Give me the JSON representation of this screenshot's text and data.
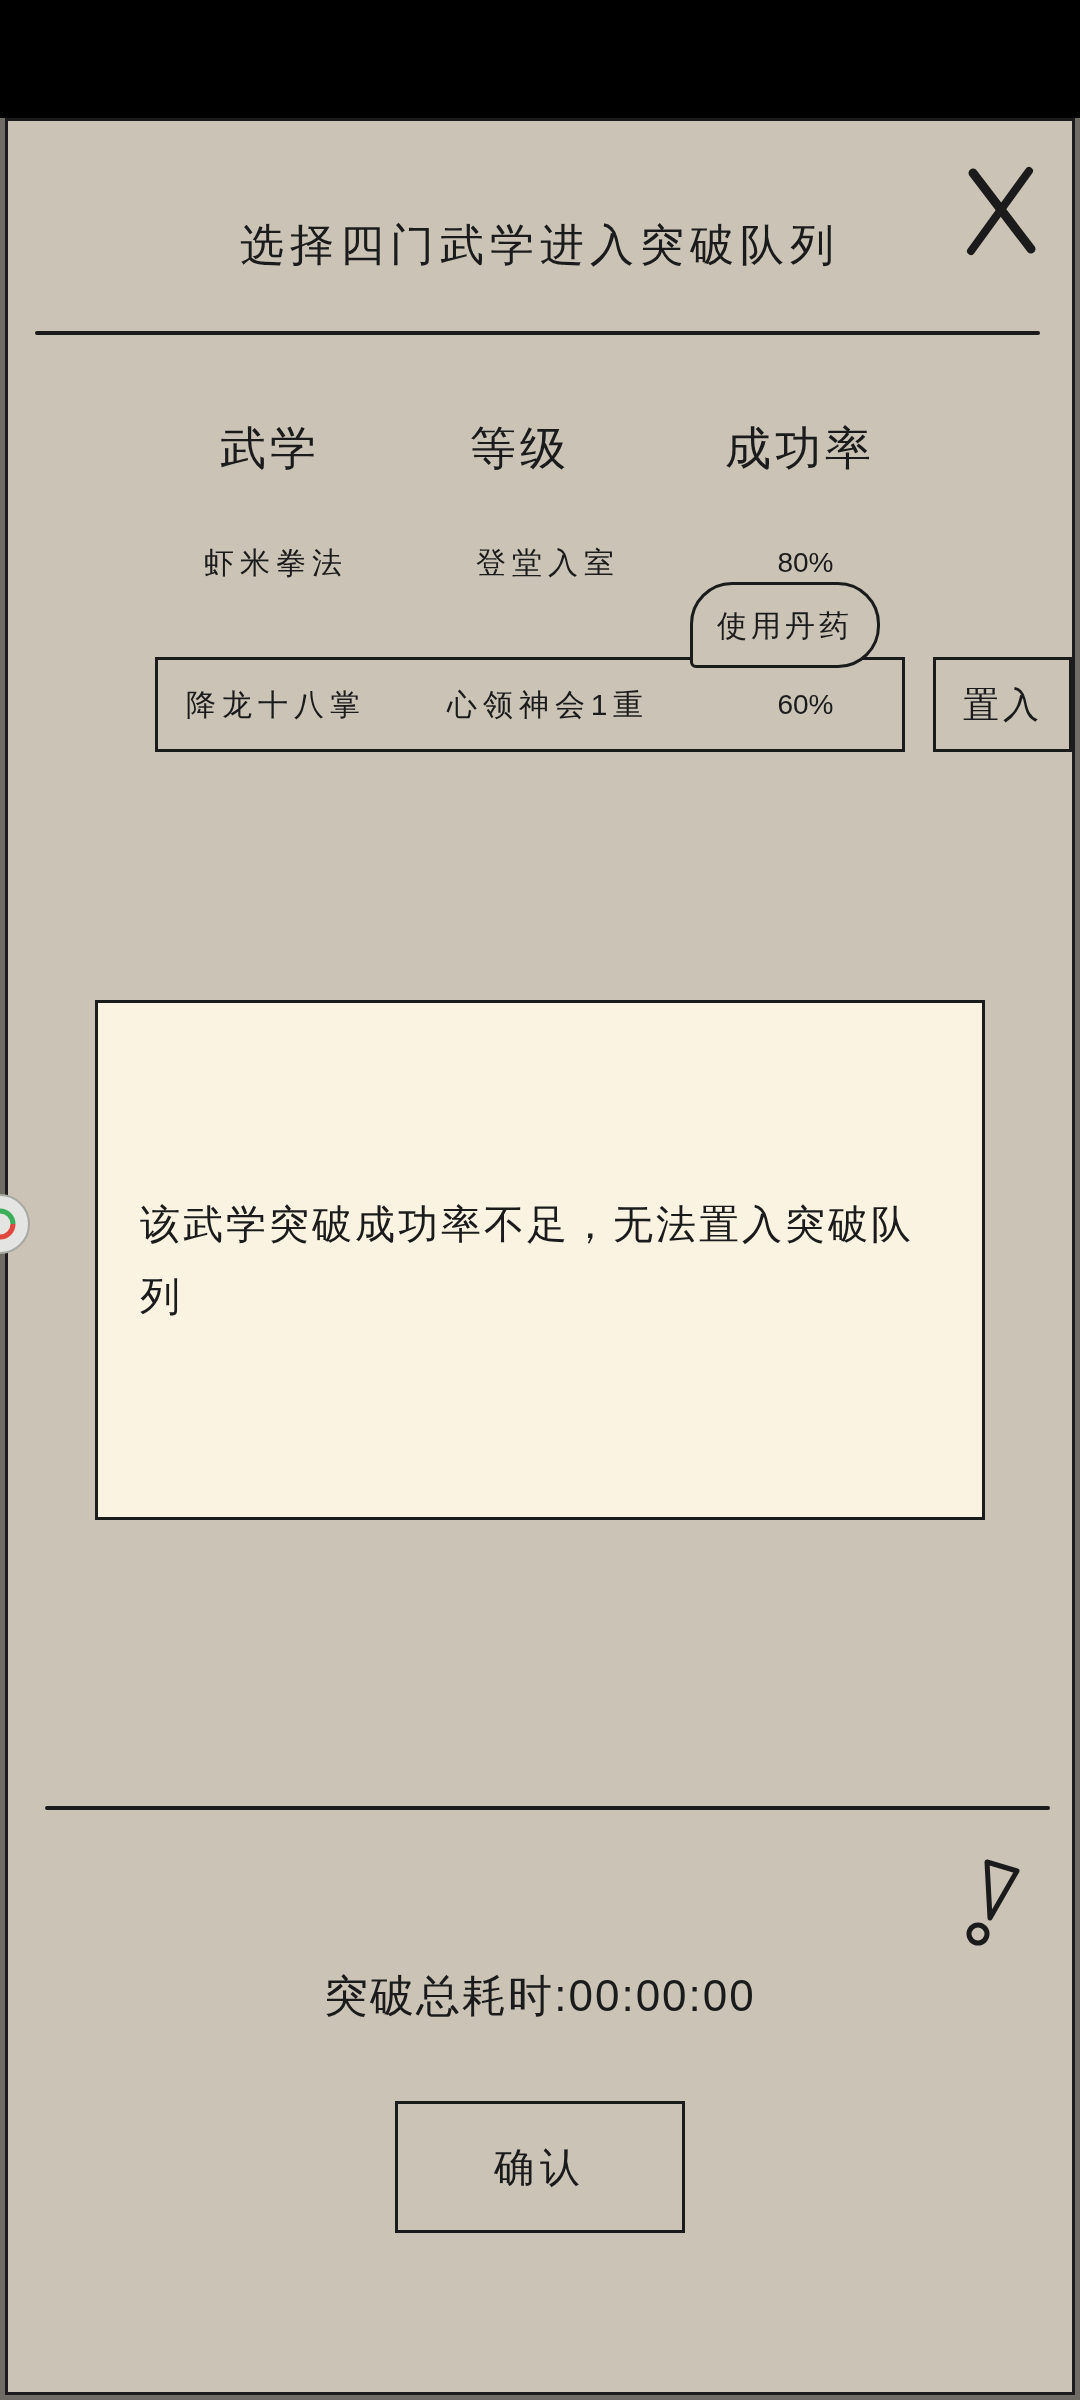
{
  "dialog": {
    "title": "选择四门武学进入突破队列"
  },
  "table": {
    "columns": [
      "武学",
      "等级",
      "成功率"
    ],
    "rows": [
      {
        "cells": [
          "虾米拳法",
          "登堂入室",
          "80%"
        ],
        "selected": false
      },
      {
        "cells": [
          "降龙十八掌",
          "心领神会1重",
          "60%"
        ],
        "selected": true,
        "hint_button": "使用丹药",
        "action_button": "置入"
      }
    ]
  },
  "message": "该武学突破成功率不足，无法置入突破队列",
  "total_time": "突破总耗时:00:00:00",
  "confirm_button": "确认"
}
